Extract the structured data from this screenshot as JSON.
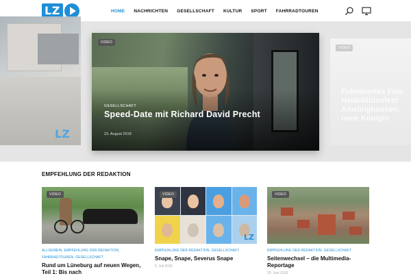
{
  "header": {
    "logo_text": "LZ",
    "nav": [
      "HOME",
      "NACHRICHTEN",
      "GESELLSCHAFT",
      "KULTUR",
      "SPORT",
      "FAHRRADTOUREN"
    ],
    "active_nav": "HOME",
    "icons": [
      "search-icon",
      "tv-icon"
    ]
  },
  "hero": {
    "left_slide": {
      "logo_text": "LZ"
    },
    "main_slide": {
      "badge": "VIDEO",
      "category": "GESELLSCHAFT",
      "title": "Speed-Date mit Richard David Precht",
      "date": "23. August 2018"
    },
    "right_slide": {
      "badge": "VIDEO",
      "title_lines": [
        "Fulminantes Fina",
        "Heideblütenfest",
        "Amelinghausen:",
        "neue Königin"
      ]
    }
  },
  "section": {
    "title": "EMPFEHLUNG DER REDAKTION",
    "cards": [
      {
        "badge": "VIDEO",
        "categories": [
          "ALLGEMEIN",
          "EMPFEHLUNG DER REDAKTION",
          "FAHRRADTOUREN",
          "GESELLSCHAFT"
        ],
        "title": "Rund um Lüneburg auf neuen Wegen, Teil 1: Bis nach",
        "date": ""
      },
      {
        "badge": "VIDEO",
        "categories": [
          "EMPFEHLUNG DER REDAKTION",
          "GESELLSCHAFT"
        ],
        "title": "Snape, Snape, Severus Snape",
        "date": "5. Juli 2018",
        "logo_text": "LZ"
      },
      {
        "badge": "VIDEO",
        "categories": [
          "EMPFEHLUNG DER REDAKTION",
          "GESELLSCHAFT"
        ],
        "title": "Seitenwechsel – die Multimedia-Reportage",
        "date": "29. Juni 2018"
      }
    ]
  },
  "colors": {
    "accent": "#1e8ed6",
    "hero_band": "#e5e5e5"
  }
}
